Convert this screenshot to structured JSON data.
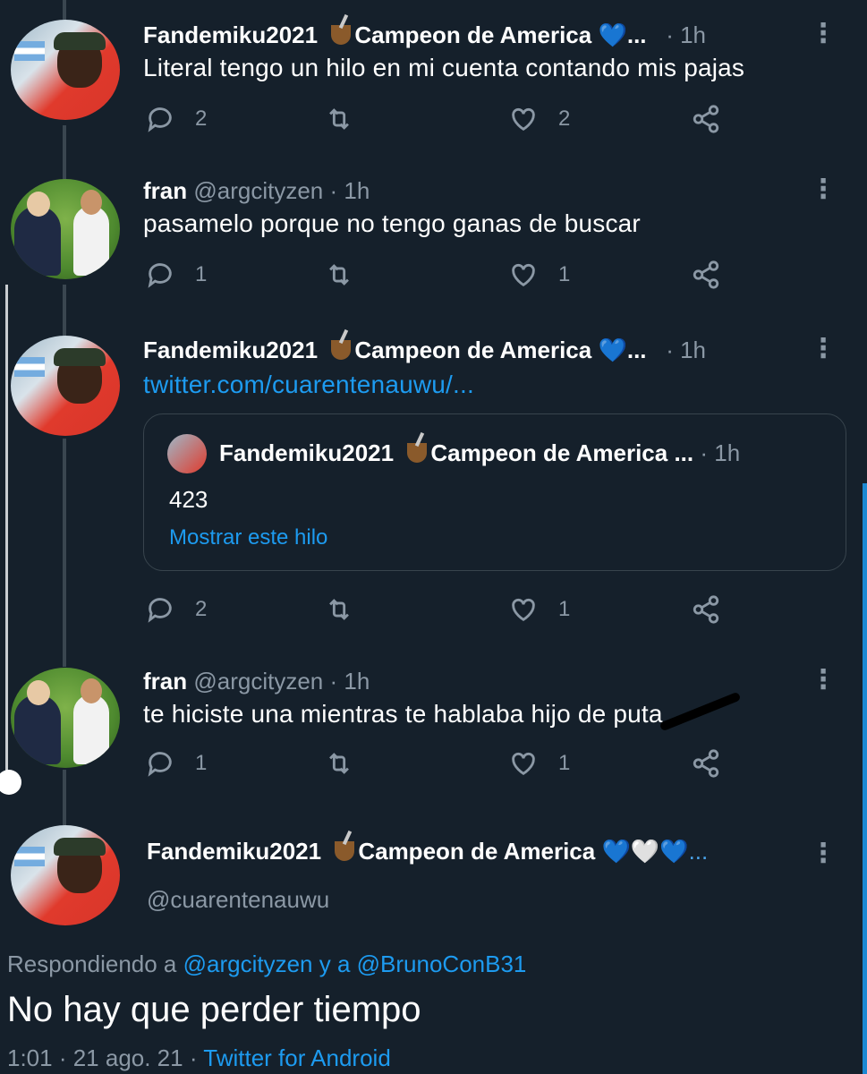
{
  "tweets": [
    {
      "name": "Fandemiku2021",
      "badge": "Campeon de America",
      "hearts": "💙",
      "ellipsis": "...",
      "handle": "",
      "time": "· 1h",
      "text": "Literal tengo un hilo en mi cuenta contando mis pajas",
      "replies": "2",
      "retweets": "",
      "likes": "2"
    },
    {
      "name": "fran",
      "handle": "@argcityzen",
      "time": "· 1h",
      "text": "pasamelo porque no tengo ganas de buscar",
      "replies": "1",
      "retweets": "",
      "likes": "1"
    },
    {
      "name": "Fandemiku2021",
      "badge": "Campeon de America",
      "hearts": "💙",
      "ellipsis": "...",
      "time": "· 1h",
      "link": "twitter.com/cuarentenauwu/...",
      "replies": "2",
      "retweets": "",
      "likes": "1"
    },
    {
      "name": "fran",
      "handle": "@argcityzen",
      "time": "· 1h",
      "text": "te hiciste una mientras te hablaba hijo de puta",
      "replies": "1",
      "retweets": "",
      "likes": "1"
    }
  ],
  "quote": {
    "name": "Fandemiku2021",
    "badge": "Campeon de America ...",
    "time": "· 1h",
    "text": "423",
    "show_thread": "Mostrar este hilo"
  },
  "main_tweet": {
    "name": "Fandemiku2021",
    "badge": "Campeon de America",
    "hearts": "💙🤍💙...",
    "handle": "@cuarentenauwu",
    "replying_prefix": "Respondiendo a ",
    "replying_user1": "@argcityzen",
    "replying_mid": " y a ",
    "replying_user2": "@BrunoConB31",
    "text": "No hay que perder tiempo",
    "timestamp": "1:01 · 21 ago. 21 · ",
    "source": "Twitter for Android"
  },
  "colors": {
    "background": "#15202b",
    "accent": "#1d9bf0",
    "muted": "#8b98a5"
  },
  "icons": [
    "reply-icon",
    "retweet-icon",
    "like-icon",
    "share-icon",
    "more-icon"
  ]
}
